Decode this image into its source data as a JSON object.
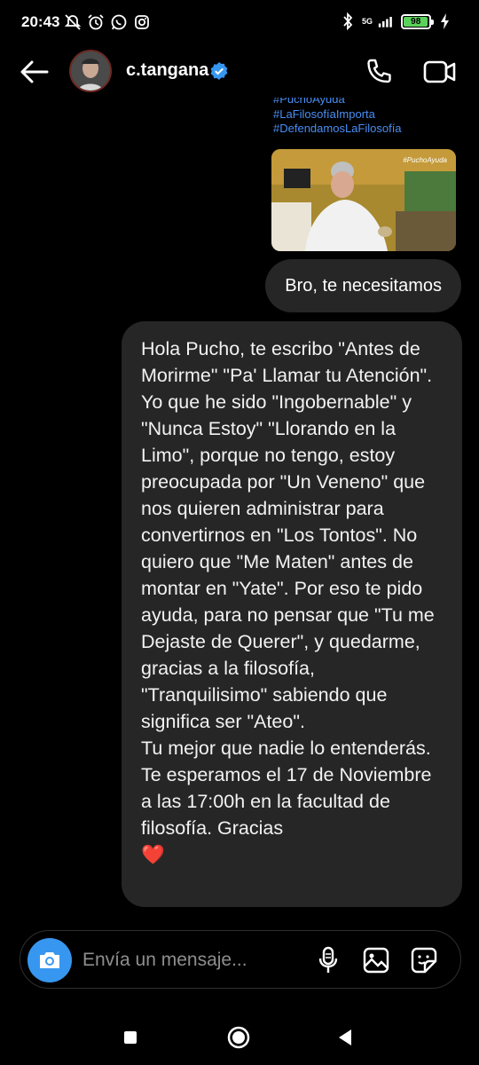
{
  "status_bar": {
    "time": "20:43",
    "network": "5G",
    "battery_level": "98",
    "icons_left": [
      "mute-notifications-icon",
      "alarm-icon",
      "whatsapp-icon",
      "instagram-icon"
    ],
    "icons_right": [
      "bluetooth-icon",
      "signal-icon",
      "battery-icon",
      "charging-icon"
    ]
  },
  "header": {
    "contact_name": "c.tangana",
    "verified": true,
    "accent_color": "#3797f0"
  },
  "messages": {
    "shared_post": {
      "hashtags": [
        "#PuchoAyuda",
        "#LaFilosofíaImporta",
        "#DefendamosLaFilosofía"
      ],
      "video_tag": "#PuchoAyuda"
    },
    "outgoing_short": "Bro, te necesitamos",
    "long_message": "Hola Pucho, te escribo \"Antes de Morirme\" \"Pa' Llamar tu Atención\". Yo que he sido \"Ingobernable\" y \"Nunca Estoy\" \"Llorando en la Limo\", porque no tengo, estoy preocupada por \"Un Veneno\" que nos quieren administrar para convertirnos en \"Los Tontos\". No quiero que \"Me Maten\" antes de montar en \"Yate\". Por eso te pido ayuda, para no pensar que \"Tu me Dejaste de Querer\", y quedarme, gracias a la filosofía, \"Tranquilisimo\" sabiendo que significa ser \"Ateo\".\nTu mejor que nadie lo entenderás. Te esperamos el 17 de Noviembre a las 17:00h en la facultad de filosofía. Gracias",
    "long_message_emoji": "❤️"
  },
  "composer": {
    "placeholder": "Envía un mensaje..."
  }
}
